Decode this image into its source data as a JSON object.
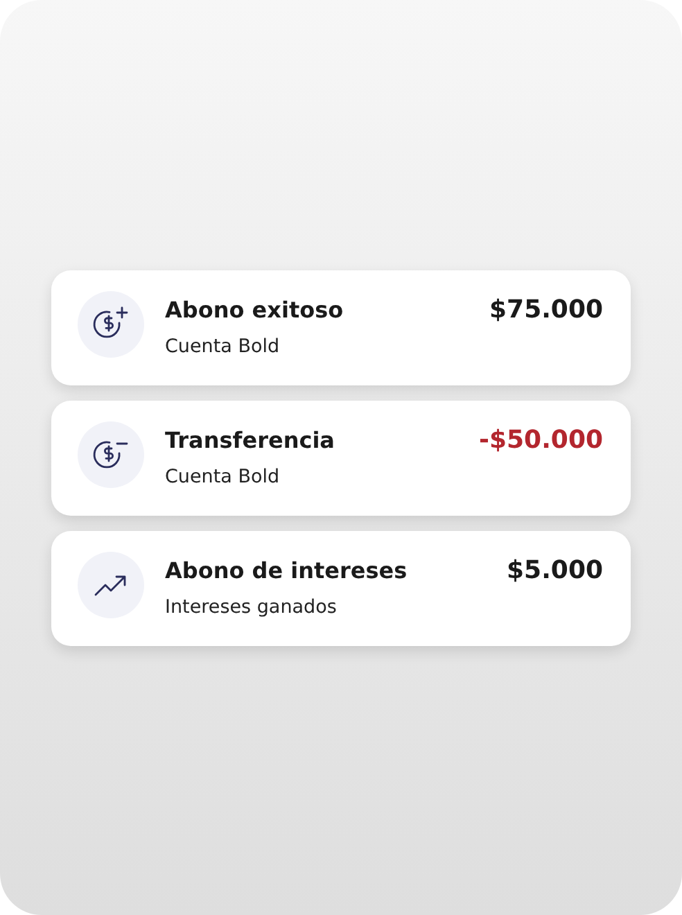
{
  "transactions": [
    {
      "kind": "deposit",
      "title": "Abono exitoso",
      "subtitle": "Cuenta Bold",
      "amount": "$75.000",
      "negative": false
    },
    {
      "kind": "withdrawal",
      "title": "Transferencia",
      "subtitle": "Cuenta Bold",
      "amount": "-$50.000",
      "negative": true
    },
    {
      "kind": "interest",
      "title": "Abono de intereses",
      "subtitle": "Intereses ganados",
      "amount": "$5.000",
      "negative": false
    }
  ]
}
